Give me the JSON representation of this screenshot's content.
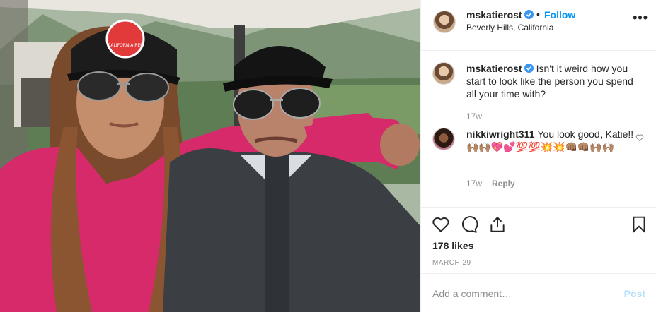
{
  "header": {
    "username": "mskatierost",
    "dot": "•",
    "follow_label": "Follow",
    "location": "Beverly Hills, California",
    "more_label": "•••"
  },
  "caption": {
    "username": "mskatierost",
    "text": "Isn't it weird how you start to look like the person you spend all your time with?",
    "time": "17w"
  },
  "comments": [
    {
      "username": "nikkiwright311",
      "text": "You look good, Katie!! 🙌🏽🙌🏽💖💕💯💯💥💥👊🏽👊🏽🙌🏽🙌🏽",
      "time": "17w",
      "reply_label": "Reply"
    }
  ],
  "post": {
    "likes": "178 likes",
    "date": "MARCH 29",
    "cap_patch_text": "CALIFORNIA REP"
  },
  "add_comment": {
    "placeholder": "Add a comment…",
    "post_label": "Post"
  },
  "colors": {
    "accent": "#0095f6",
    "post_disabled": "#b2dffc",
    "muted": "#8e8e8e",
    "verified": "#3897f0"
  },
  "icons": [
    "verified-badge-icon",
    "more-options-icon",
    "heart-icon",
    "comment-icon",
    "share-icon",
    "bookmark-icon",
    "small-heart-icon"
  ]
}
